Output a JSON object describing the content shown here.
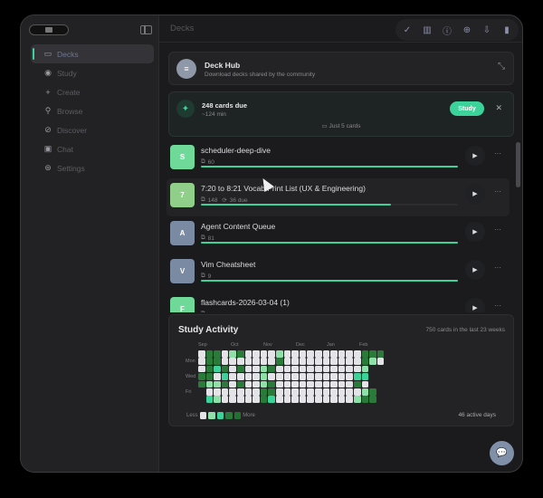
{
  "sidebar": {
    "items": [
      {
        "label": "Decks",
        "icon": "deck-icon",
        "active": true
      },
      {
        "label": "Study",
        "icon": "eye-icon"
      },
      {
        "label": "Create",
        "icon": "plus-icon"
      },
      {
        "label": "Browse",
        "icon": "search-icon"
      },
      {
        "label": "Discover",
        "icon": "compass-icon"
      },
      {
        "label": "Chat",
        "icon": "chat-icon"
      },
      {
        "label": "Settings",
        "icon": "settings-icon"
      }
    ]
  },
  "header": {
    "title": "Decks",
    "tools": [
      "check-circle-icon",
      "bar-chart-icon",
      "info-icon",
      "globe-icon",
      "import-icon",
      "stats-icon"
    ]
  },
  "hub": {
    "title": "Deck Hub",
    "subtitle": "Download decks shared by the community"
  },
  "due": {
    "title": "248 cards due",
    "subtitle": "~124 min",
    "study_label": "Study",
    "just_label": "Just 5 cards"
  },
  "decks": [
    {
      "initial": "S",
      "name": "scheduler-deep-dive",
      "cards": "60",
      "due": null,
      "progress": 1.0,
      "color": "#6fd99a"
    },
    {
      "initial": "7",
      "name": "7:20 to 8:21 Vocab Print List (UX & Engineering)",
      "cards": "148",
      "due": "36 due",
      "progress": 0.74,
      "color": "#8fcf8a"
    },
    {
      "initial": "A",
      "name": "Agent Content Queue",
      "cards": "81",
      "due": null,
      "progress": 1.0,
      "color": "#7a8aa3"
    },
    {
      "initial": "V",
      "name": "Vim Cheatsheet",
      "cards": "9",
      "due": null,
      "progress": 1.0,
      "color": "#7a8aa3"
    },
    {
      "initial": "F",
      "name": "flashcards-2026-03-04 (1)",
      "cards": "",
      "due": null,
      "progress": 1.0,
      "color": "#6fd99a"
    }
  ],
  "activity": {
    "title": "Study Activity",
    "summary": "750 cards in the last 23 weeks",
    "active_days": "46 active days",
    "months": [
      "Sep",
      "Oct",
      "Nov",
      "Dec",
      "Jan",
      "Feb"
    ],
    "days": [
      "Mon",
      "Wed",
      "Fri"
    ],
    "less": "Less",
    "more": "More",
    "colors": [
      "#e4e4e8",
      "#8fe0a8",
      "#3bd39a",
      "#2a7a3a",
      "#237033"
    ],
    "rows": [
      "033013000010000000000333",
      "033000000030000000000310",
      "0323030013000000000001-",
      "3302000010000000000022",
      "3113030013000000000030",
      "-0000000330000000000013",
      "-2100000320000000000133"
    ]
  }
}
